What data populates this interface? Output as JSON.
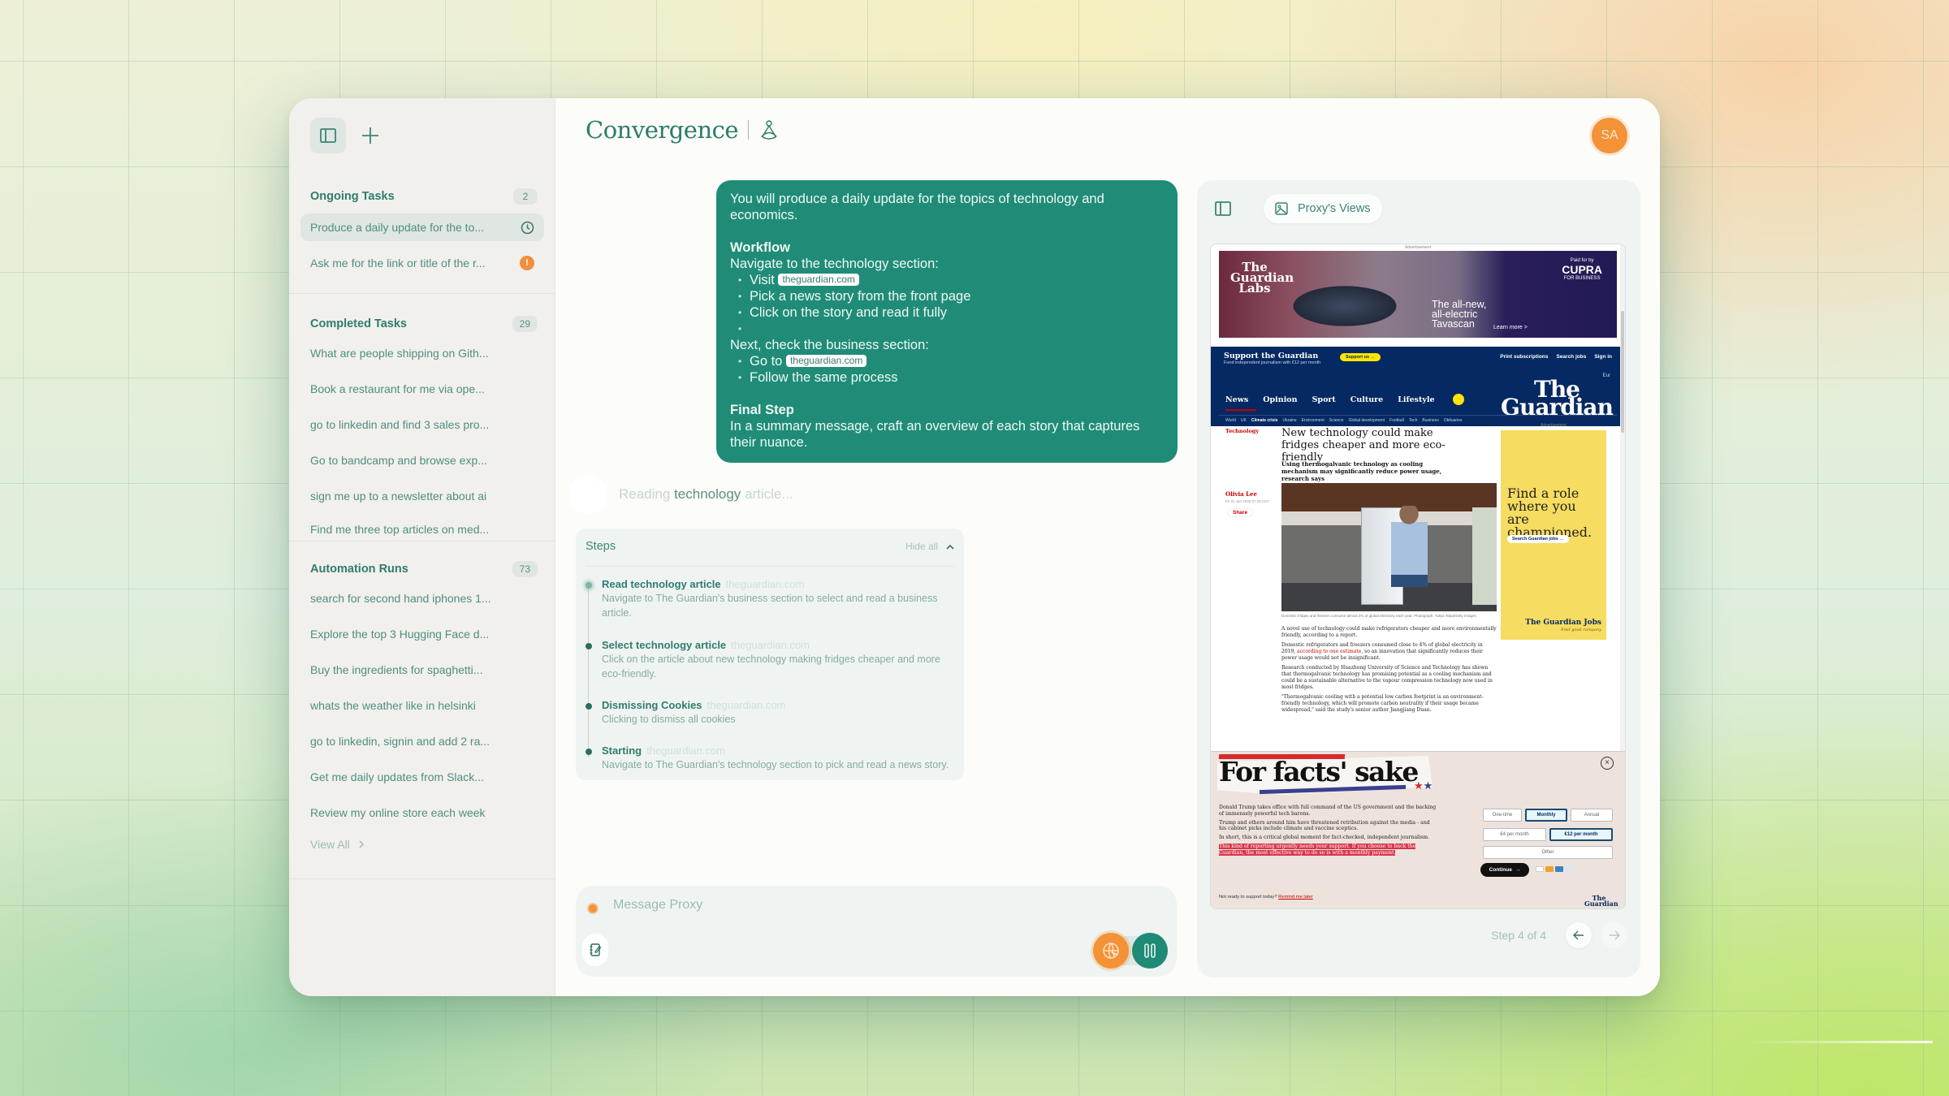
{
  "app": {
    "title": "Convergence",
    "user_initials": "SA"
  },
  "colors": {
    "accent": "#208c78",
    "orange": "#f39237",
    "sidebar_bg": "#f1f0ec",
    "panel_bg": "#eff4f2"
  },
  "sidebar": {
    "toggle_icon": "sidebar-toggle-icon",
    "new_icon": "plus-icon",
    "ongoing": {
      "title": "Ongoing Tasks",
      "count": "2",
      "items": [
        {
          "label": "Produce a daily update for the to...",
          "status_icon": "clock-icon"
        },
        {
          "label": "Ask me for the link or title of the r...",
          "status_icon": "alert-icon",
          "status_glyph": "!"
        }
      ]
    },
    "completed": {
      "title": "Completed Tasks",
      "count": "29",
      "items": [
        {
          "label": "What are people shipping on Gith..."
        },
        {
          "label": "Book a restaurant for me via ope..."
        },
        {
          "label": "go to linkedin and find 3 sales pro..."
        },
        {
          "label": "Go to bandcamp and browse exp..."
        },
        {
          "label": "sign me up to a newsletter about ai"
        },
        {
          "label": "Find me three top articles on med..."
        }
      ]
    },
    "automation": {
      "title": "Automation Runs",
      "count": "73",
      "items": [
        {
          "label": "search for second hand iphones 1..."
        },
        {
          "label": "Explore the top 3 Hugging Face d..."
        },
        {
          "label": "Buy the ingredients for spaghetti..."
        },
        {
          "label": "whats the weather like in helsinki"
        },
        {
          "label": "go to linkedin, signin and add 2 ra..."
        },
        {
          "label": "Get me daily updates from Slack..."
        },
        {
          "label": "Review my online store each week"
        }
      ],
      "view_all": "View All"
    }
  },
  "chat": {
    "user_message": {
      "intro": "You will produce a daily update for the topics of technology and economics.",
      "workflow_heading": "Workflow",
      "tech_intro": "Navigate to the technology section:",
      "tech_steps": [
        {
          "text": "Visit",
          "chip": "theguardian.com"
        },
        {
          "text": "Pick a news story from the front page"
        },
        {
          "text": "Click on the story and read it fully"
        },
        {
          "text": ""
        }
      ],
      "business_intro": "Next, check the business section:",
      "business_steps": [
        {
          "text": "Go to",
          "chip": "theguardian.com"
        },
        {
          "text": "Follow the same process"
        }
      ],
      "final_heading": "Final Step",
      "final_text": "In a summary message, craft an overview of each story that captures their nuance."
    },
    "status": {
      "prefix": "Reading",
      "highlight": "technology",
      "suffix": "article..."
    },
    "steps_panel": {
      "title": "Steps",
      "hide_label": "Hide all",
      "steps": [
        {
          "title": "Read technology article",
          "source": "theguardian.com",
          "desc": "Navigate to The Guardian's business section to select and read a business article.",
          "state": "in-progress"
        },
        {
          "title": "Select technology article",
          "source": "theguardian.com",
          "desc": "Click on the article about new technology making fridges cheaper and more eco-friendly.",
          "state": "done"
        },
        {
          "title": "Dismissing Cookies",
          "source": "theguardian.com",
          "desc": "Clicking to dismiss all cookies",
          "state": "done"
        },
        {
          "title": "Starting",
          "source": "theguardian.com",
          "desc": "Navigate to The Guardian's technology section to pick and read a news story.",
          "state": "done"
        }
      ]
    },
    "composer": {
      "placeholder": "Message Proxy",
      "value": ""
    }
  },
  "views_panel": {
    "pill_label": "Proxy's Views",
    "step_counter": "Step 4 of 4",
    "screenshot": {
      "ad_label": "Advertisement",
      "car_ad": {
        "brand": "The Guardian Labs",
        "headline": "The all-new, all-electric Tavascan",
        "cta": "Learn more >",
        "paid_by": "Paid for by",
        "sponsor": "CUPRA",
        "sponsor_sub": "FOR BUSINESS"
      },
      "header": {
        "support_title": "Support the Guardian",
        "support_sub": "Fund independent journalism with €12 per month",
        "support_btn": "Support us →",
        "top_links": [
          "Print subscriptions",
          "Search jobs",
          "Sign in"
        ],
        "edition": "Eur",
        "logo": "The Guardian",
        "nav": [
          "News",
          "Opinion",
          "Sport",
          "Culture",
          "Lifestyle"
        ],
        "subnav": [
          "World",
          "UK",
          "Climate crisis",
          "Ukraine",
          "Environment",
          "Science",
          "Global development",
          "Football",
          "Tech",
          "Business",
          "Obituaries"
        ]
      },
      "article": {
        "kicker": "Technology",
        "headline": "New technology could make fridges cheaper and more eco-friendly",
        "standfirst": "Using thermogalvanic technology as cooling mechanism may significantly reduce power usage, research says",
        "author": "Olivia Lee",
        "date": "Fri 31 Jan 2025 07.00 CET",
        "share": "Share",
        "caption": "Domestic fridges and freezers consume almost 4% of global electricity each year. Photograph: Yuliya Taba/Getty Images",
        "paragraphs": [
          "A novel use of technology could make refrigerators cheaper and more environmentally friendly, according to a report.",
          "Domestic refrigerators and freezers consumed close to 4% of global electricity in 2019, according to one estimate, so an innovation that significantly reduces their power usage would not be insignificant.",
          "Research conducted by Huazhong University of Science and Technology has shown that thermogalvanic technology has promising potential as a cooling mechanism and could be a sustainable alternative to the vapour compression technology now used in most fridges.",
          "\"Thermogalvanic cooling with a potential low carbon footprint is an environment-friendly technology, which will promote carbon neutrality if their usage became widespread,\" said the study's senior author Jiangjiang Duan."
        ]
      },
      "jobs_ad": {
        "label": "Advertisement",
        "headline": "Find a role where you are championed.",
        "cta": "Search Guardian jobs →",
        "logo": "The Guardian Jobs",
        "tagline": "Find good company"
      },
      "support_banner": {
        "title": "For facts' sake",
        "paragraphs": [
          "Donald Trump takes office with full command of the US government and the backing of immensely powerful tech barons.",
          "Trump and others around him have threatened retribution against the media - and his cabinet picks include climate and vaccine sceptics.",
          "In short, this is a critical global moment for fact-checked, independent journalism."
        ],
        "highlight": "This kind of reporting urgently needs your support. If you choose to back the Guardian, the most effective way to do so is with a monthly payment.",
        "frequency_options": [
          "One-time",
          "Monthly",
          "Annual"
        ],
        "selected_frequency": "Monthly",
        "amount_options": [
          "€4 per month",
          "€12 per month"
        ],
        "selected_amount": "€12 per month",
        "other_label": "Other",
        "continue_label": "Continue",
        "not_ready": "Not ready to support today?",
        "remind": "Remind me later",
        "logo": "The Guardian"
      }
    }
  }
}
